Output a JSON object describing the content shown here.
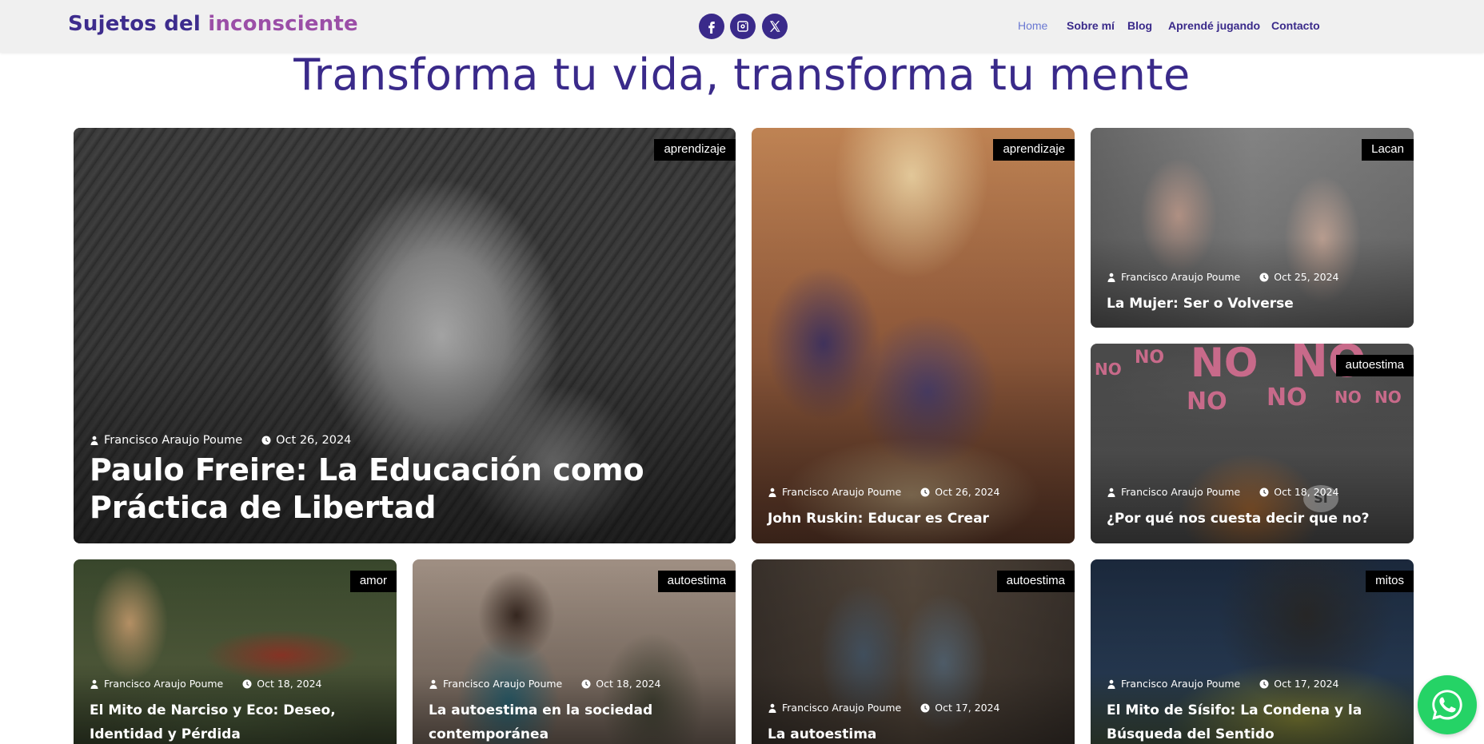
{
  "site": {
    "logo_part1": "Sujetos del",
    "logo_part2": "inconsciente"
  },
  "social": [
    "facebook-icon",
    "instagram-icon",
    "x-icon"
  ],
  "nav": {
    "home": "Home",
    "about": "Sobre mí",
    "blog": "Blog",
    "learn": "Aprendé jugando",
    "contact": "Contacto"
  },
  "headline": "Transforma tu vida, transforma tu mente",
  "colors": {
    "brand": "#3a2a8a",
    "accent": "#9b4ea7",
    "nav_active": "#6a78d2",
    "whatsapp": "#25d366"
  },
  "posts": [
    {
      "tag": "aprendizaje",
      "author": "Francisco Araujo Poume",
      "date": "Oct 26, 2024",
      "title": "Paulo Freire: La Educación como Práctica de Libertad"
    },
    {
      "tag": "aprendizaje",
      "author": "Francisco Araujo Poume",
      "date": "Oct 26, 2024",
      "title": "John Ruskin: Educar es Crear"
    },
    {
      "tag": "Lacan",
      "author": "Francisco Araujo Poume",
      "date": "Oct 25, 2024",
      "title": "La Mujer: Ser o Volverse"
    },
    {
      "tag": "autoestima",
      "author": "Francisco Araujo Poume",
      "date": "Oct 18, 2024",
      "title": "¿Por qué nos cuesta decir que no?"
    },
    {
      "tag": "amor",
      "author": "Francisco Araujo Poume",
      "date": "Oct 18, 2024",
      "title": "El Mito de Narciso y Eco: Deseo, Identidad y Pérdida"
    },
    {
      "tag": "autoestima",
      "author": "Francisco Araujo Poume",
      "date": "Oct 18, 2024",
      "title": "La autoestima en la sociedad contemporánea"
    },
    {
      "tag": "autoestima",
      "author": "Francisco Araujo Poume",
      "date": "Oct 17, 2024",
      "title": "La autoestima"
    },
    {
      "tag": "mitos",
      "author": "Francisco Araujo Poume",
      "date": "Oct 17, 2024",
      "title": "El Mito de Sísifo: La Condena y la Búsqueda del Sentido"
    }
  ],
  "image_overlay_text": {
    "no_word": "NO",
    "si_word": "SI"
  }
}
